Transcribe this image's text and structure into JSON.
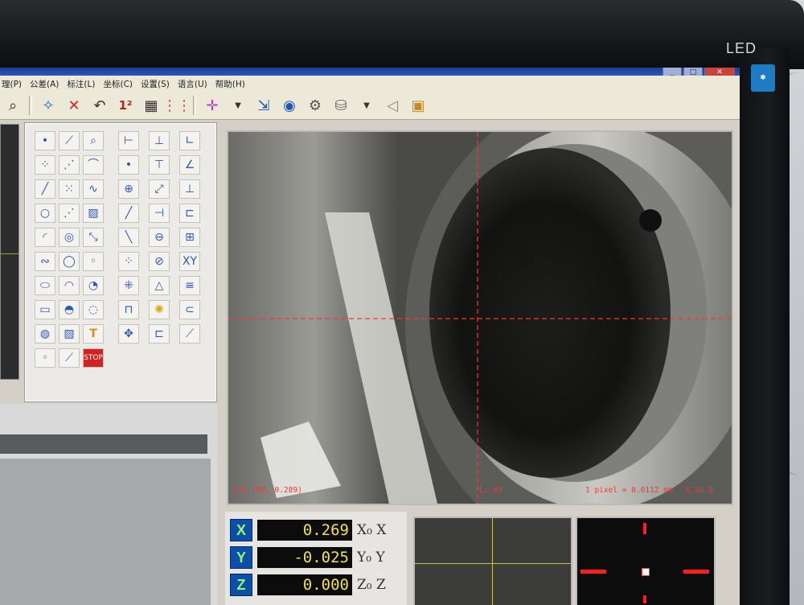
{
  "monitor": {
    "brand_label": "LED",
    "sticker_icon": "energy-star-icon"
  },
  "window": {
    "buttons": [
      "minimize",
      "maximize",
      "close"
    ]
  },
  "menu": {
    "items": [
      "理(P)",
      "公差(A)",
      "标注(L)",
      "坐标(C)",
      "设置(S)",
      "语言(U)",
      "帮助(H)"
    ]
  },
  "toolbar": {
    "icons": [
      "zoom-icon",
      "cursor-cross-icon",
      "delete-icon",
      "undo-icon",
      "sequence-icon",
      "grid-icon",
      "column-grid-icon",
      "crosshair-icon",
      "export-icon",
      "camera-icon",
      "settings-gear-icon",
      "database-icon",
      "speaker-icon",
      "image-icon"
    ]
  },
  "palette": {
    "tools": [
      "point-icon",
      "line-point-icon",
      "zoom-point-icon",
      "width-icon",
      "vertical-dist-icon",
      "angle-icon",
      "multi-point-icon",
      "dotted-line-icon",
      "arc-icon",
      "point-pick-icon",
      "horizontal-dist-icon",
      "angle-measure-icon",
      "line-icon",
      "point-cloud-icon",
      "curve-icon",
      "circle-center-icon",
      "diagonal-dist-icon",
      "level-icon",
      "circle-icon",
      "line-fit-icon",
      "hatch-icon",
      "red-line-icon",
      "vertical-bar-icon",
      "bracket-icon",
      "arc-tool-icon",
      "concentric-icon",
      "diagonal-icon",
      "slash-icon",
      "circle-measure-icon",
      "coord-icon",
      "spline-icon",
      "circle-fit-icon",
      "small-circle-icon",
      "dots-grid-icon",
      "circle-dist-icon",
      "xy-label-icon",
      "ellipse-icon",
      "arc-fit-icon",
      "sector-icon",
      "cross-dots-icon",
      "triangle-icon",
      "stack-icon",
      "rectangle-icon",
      "half-circle-icon",
      "ring-icon",
      "caliper-icon",
      "lightbulb-icon",
      "slot-icon",
      "ring-fit-icon",
      "hatch-fit-icon",
      "text-tool-icon",
      "move-icon",
      "key-slot-icon",
      "line-pick-icon",
      "circle-pick-icon",
      "pen-icon",
      "stop-icon"
    ]
  },
  "camera": {
    "coords_text": "(37.700, 0.289)",
    "length_text": "L: 43",
    "pixel_text": "1 pixel = 0.0112 mm",
    "zoom_text": "X 24.9"
  },
  "readout": {
    "x": {
      "label": "X",
      "value": "0.269",
      "sub": "X₀ X"
    },
    "y": {
      "label": "Y",
      "value": "-0.025",
      "sub": "Y₀ Y"
    },
    "z": {
      "label": "Z",
      "value": "0.000",
      "sub": "Z₀ Z"
    }
  },
  "colors": {
    "accent_blue": "#0a4fa8",
    "axis_green": "#9ff06a",
    "readout_yellow": "#f0e24a",
    "crosshair_red": "#ff3333",
    "yellow_line": "#c6c341"
  }
}
